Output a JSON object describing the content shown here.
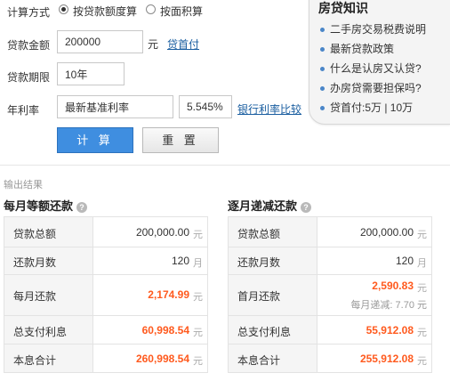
{
  "calc_form": {
    "method_label": "计算方式",
    "method_option_1": "按贷款额度算",
    "method_option_2": "按面积算",
    "loan_amount_label": "贷款金额",
    "loan_amount_value": "200000",
    "loan_amount_unit": "元",
    "down_payment_link": "贷首付",
    "term_label": "贷款期限",
    "term_value": "10年",
    "rate_label": "年利率",
    "rate_type_value": "最新基准利率",
    "rate_value": "5.545%",
    "rate_compare_link": "银行利率比较",
    "calc_button": "计 算",
    "reset_button": "重 置"
  },
  "knowledge_panel": {
    "title": "房贷知识",
    "items": [
      "二手房交易税费说明",
      "最新贷款政策",
      "什么是认房又认贷?",
      "办房贷需要担保吗?",
      "贷首付:5万 | 10万"
    ]
  },
  "results": {
    "section_title": "输出结果",
    "equal_installment": {
      "heading": "每月等额还款",
      "rows": [
        {
          "label": "贷款总额",
          "value": "200,000.00",
          "unit": "元"
        },
        {
          "label": "还款月数",
          "value": "120",
          "unit": "月"
        },
        {
          "label": "每月还款",
          "value": "2,174.99",
          "unit": "元"
        },
        {
          "label": "总支付利息",
          "value": "60,998.54",
          "unit": "元"
        },
        {
          "label": "本息合计",
          "value": "260,998.54",
          "unit": "元"
        }
      ]
    },
    "decreasing": {
      "heading": "逐月递减还款",
      "rows": [
        {
          "label": "贷款总额",
          "value": "200,000.00",
          "unit": "元"
        },
        {
          "label": "还款月数",
          "value": "120",
          "unit": "月"
        },
        {
          "label": "首月还款",
          "value": "2,590.83",
          "unit": "元",
          "sub": "每月递减: 7.70 元"
        },
        {
          "label": "总支付利息",
          "value": "55,912.08",
          "unit": "元"
        },
        {
          "label": "本息合计",
          "value": "255,912.08",
          "unit": "元"
        }
      ]
    }
  },
  "colors": {
    "accent_blue": "#3f8ee0",
    "highlight_red": "#ff5a1e",
    "link_blue": "#1a5ea0"
  }
}
